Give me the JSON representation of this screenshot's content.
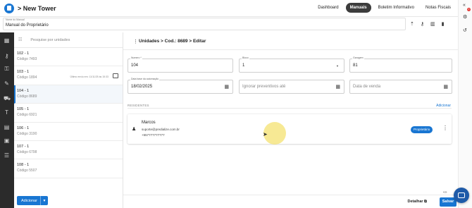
{
  "app": {
    "title": "> New Tower"
  },
  "nav": {
    "tabs": [
      {
        "label": "Dashboard",
        "active": false
      },
      {
        "label": "Manuais",
        "active": true
      },
      {
        "label": "Boletim Informativo",
        "active": false
      },
      {
        "label": "Notas Fiscais",
        "active": false
      }
    ]
  },
  "manual": {
    "label": "Nome do Manual",
    "value": "Manual do Proprietário"
  },
  "right_strip": {
    "badge": "0"
  },
  "units": {
    "search_placeholder": "Pesquise por unidades",
    "items": [
      {
        "name": "102 - 1",
        "code": "Código 7493",
        "selected": false,
        "note": ""
      },
      {
        "name": "103 - 1",
        "code": "Código 1894",
        "selected": false,
        "note": "Último envio em: 11/11/25 às 15:33"
      },
      {
        "name": "104 - 1",
        "code": "Código 8689",
        "selected": true,
        "note": ""
      },
      {
        "name": "105 - 1",
        "code": "Código 6921",
        "selected": false,
        "note": ""
      },
      {
        "name": "106 - 1",
        "code": "Código 3190",
        "selected": false,
        "note": ""
      },
      {
        "name": "107 - 1",
        "code": "Código 6798",
        "selected": false,
        "note": ""
      },
      {
        "name": "108 - 1",
        "code": "Código 5507",
        "selected": false,
        "note": ""
      }
    ],
    "add_label": "Adicionar"
  },
  "main": {
    "breadcrumb": "Unidades > Cod.: 8689 > Editar",
    "fields": {
      "numero": {
        "label": "Numero *",
        "value": "104"
      },
      "bloco": {
        "label": "Bloco",
        "value": "1"
      },
      "garagem": {
        "label": "Garagem",
        "value": "81"
      },
      "data_base": {
        "label": "Data base da automação",
        "value": "18/02/2025"
      },
      "ignorar": {
        "placeholder": "Ignorar preventivos até"
      },
      "venda": {
        "placeholder": "Data de venda"
      }
    },
    "residents_title": "RESIDENTES",
    "residents_add": "Adicionar",
    "resident": {
      "name": "Marcos",
      "email": "suporte@predialize.com.br",
      "phone": "+557777777777",
      "role": "Proprietário"
    }
  },
  "footer": {
    "detail_label": "Detalhar",
    "save_label": "Salvar"
  },
  "colors": {
    "accent": "#1976d2",
    "sidebar": "#2b2b2b"
  }
}
